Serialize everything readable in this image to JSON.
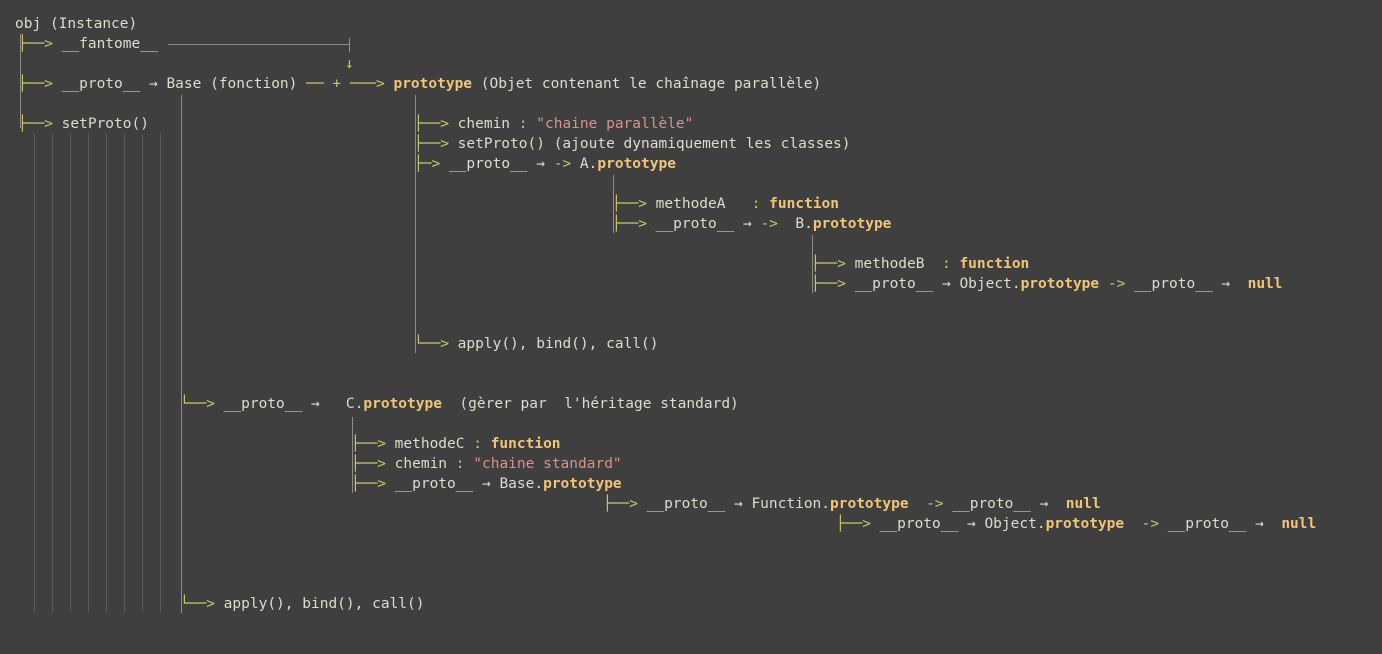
{
  "root": "obj",
  "root_paren": "(Instance)",
  "fantome": "__fantome__",
  "proto": "__proto__",
  "base_fn": "Base",
  "base_paren": "(fonction)",
  "setproto": "setProto",
  "prototype_kw": "prototype",
  "proto_paren": "(Objet contenant le chaînage parallèle)",
  "chemin": "chemin",
  "chemin_parallel": "\"chaine parallèle\"",
  "setproto_paren": "(ajoute dynamiquement les classes)",
  "a_cls": "A",
  "methodeA": "methodeA",
  "function_kw": "function",
  "b_cls": "B",
  "methodeB": "methodeB",
  "object_cls": "Object",
  "null_kw": "null",
  "apply_txt": "apply",
  "bind_txt": "bind",
  "call_txt": "call",
  "c_cls": "C",
  "c_paren": "(gèrer par  l'héritage standard)",
  "methodeC": "methodeC",
  "chemin_standard": "\"chaine standard\"",
  "function_cls": "Function",
  "arrow_mid": "→",
  "arrow_down": "↓",
  "arrow_cross": "+",
  "colors": {
    "background": "#3f3f3f",
    "text": "#dcdccc",
    "arrow": "#c8c86a",
    "keyword": "#f0c674",
    "string": "#d7938a"
  }
}
